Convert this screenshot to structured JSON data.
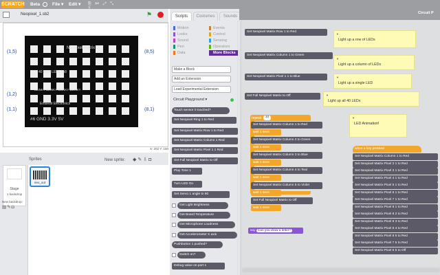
{
  "app": {
    "logo": "SCRATCH",
    "beta": "Beta",
    "menus": [
      "File ▾",
      "Edit ▾"
    ]
  },
  "stage": {
    "project_name": "Neopixel_1.sb2",
    "coords": "X: 202 Y: 160",
    "board": {
      "title": "Neopixel Matrix",
      "leds_label": "40 RGB LEDs 5x8",
      "blinky": "BLINKY BLINKY BLINKY BLINKY",
      "brand": "Embedit Electronics",
      "pins": "#6  GND 3.3V  5V",
      "corners": {
        "tl": "(1,5)",
        "tr": "(8,5)",
        "ml": "(1,2)",
        "bl": "(1,1)",
        "br": "(8,1)"
      }
    }
  },
  "sprites": {
    "header": "Sprites",
    "new_sprite": "New sprite:",
    "stage_label": "Stage",
    "backdrops": "1 backdrop",
    "new_backdrop": "New backdrop:",
    "sprite_name": "neo_out"
  },
  "tabs": [
    "Scripts",
    "Costumes",
    "Sounds"
  ],
  "categories": {
    "left": [
      {
        "name": "Motion",
        "color": "#4a6cd4"
      },
      {
        "name": "Looks",
        "color": "#8a55d7"
      },
      {
        "name": "Sound",
        "color": "#bb42c3"
      },
      {
        "name": "Pen",
        "color": "#0e9a6c"
      },
      {
        "name": "Data",
        "color": "#ee7d16"
      }
    ],
    "right": [
      {
        "name": "Events",
        "color": "#c88330"
      },
      {
        "name": "Control",
        "color": "#e1a91a"
      },
      {
        "name": "Sensing",
        "color": "#2ca5e2"
      },
      {
        "name": "Operators",
        "color": "#5cb712"
      },
      {
        "name": "More Blocks",
        "color": "#632d99"
      }
    ]
  },
  "palette": {
    "buttons": [
      "Make a Block",
      "Add an Extension",
      "Load Experimental Extension"
    ],
    "extension": "Circuit Playground ▾",
    "blocks": [
      "Touch sensor 0 touched?",
      "Set Neopixel Ring 1 to Red",
      "Set Neopixel Matrix Row 1 to Red",
      "Set Neopixel Matrix Column 1 Red",
      "Set Neopixel Matrix Pixel 1 1 Red",
      "Set Full Neopixel Matrix to Off",
      "Play Tone 1",
      "Turn LED On",
      "Set Servo 1 angle to 90",
      "Get Light Brightness",
      "Get Board Temperature",
      "Get Microphone Loudness",
      "Get Accelerometer X axis",
      "Pushbutton 1 pushed?",
      "Switch on?",
      "Debug value on port 1"
    ]
  },
  "scripts": {
    "header": "Circuit P",
    "notes": [
      "Light up a row of LEDs",
      "Light up a column of LEDs",
      "Light up a single LED",
      "Light up all 40 LEDs",
      "LED Animation!"
    ],
    "standalone": [
      "Set Neopixel Matrix Row 1 to Red",
      "Set Neopixel Matrix Column 1 to Green",
      "Set Neopixel Matrix Pixel 1 1 to Blue",
      "Set Full Neopixel Matrix to Off"
    ],
    "repeat": {
      "label": "repeat",
      "count": "10"
    },
    "loop": [
      "Set Neopixel Matrix Column 1 to Red",
      "Set Neopixel Matrix Column 2 to Green",
      "Set Neopixel Matrix Column 3 to Blue",
      "Set Neopixel Matrix Column 4 to Teal",
      "Set Neopixel Matrix Column 5 to Violet",
      "Set Full Neopixel Matrix to Off"
    ],
    "wait": "wait 1 secs",
    "say": {
      "label": "say",
      "value": "Can you draw a letter?"
    },
    "hat": "when a key pressed",
    "right_stack": [
      "Set Neopixel Matrix Column 1 to Red",
      "Set Neopixel Matrix Pixel 2 1 to Red",
      "Set Neopixel Matrix Pixel 3 1 to Red",
      "Set Neopixel Matrix Pixel 4 1 to Red",
      "Set Neopixel Matrix Pixel 5 1 to Red",
      "Set Neopixel Matrix Pixel 6 1 to Red",
      "Set Neopixel Matrix Pixel 7 1 to Red",
      "Set Neopixel Matrix Pixel 8 1 to Red",
      "Set Neopixel Matrix Pixel 8 2 to Red",
      "Set Neopixel Matrix Pixel 8 3 to Red",
      "Set Neopixel Matrix Pixel 8 4 to Red",
      "Set Neopixel Matrix Pixel 8 5 to Red",
      "Set Neopixel Matrix Pixel 7 5 to Red",
      "Set Neopixel Matrix Pixel 6 5 to Off"
    ]
  }
}
